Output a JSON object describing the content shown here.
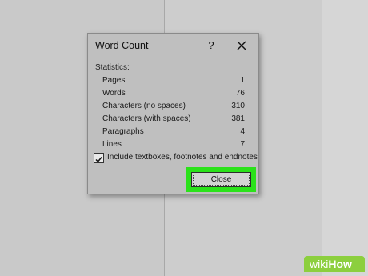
{
  "dialog": {
    "title": "Word Count",
    "help_label": "?",
    "stats_heading": "Statistics:",
    "stats": [
      {
        "label": "Pages",
        "value": "1"
      },
      {
        "label": "Words",
        "value": "76"
      },
      {
        "label": "Characters (no spaces)",
        "value": "310"
      },
      {
        "label": "Characters (with spaces)",
        "value": "381"
      },
      {
        "label": "Paragraphs",
        "value": "4"
      },
      {
        "label": "Lines",
        "value": "7"
      }
    ],
    "checkbox_label": "Include textboxes, footnotes and endnotes",
    "checkbox_checked": true,
    "close_label": "Close"
  },
  "colors": {
    "highlight": "#2be21a",
    "watermark_bg": "#8ccf3e"
  },
  "watermark": {
    "part1": "wiki",
    "part2": "How"
  }
}
